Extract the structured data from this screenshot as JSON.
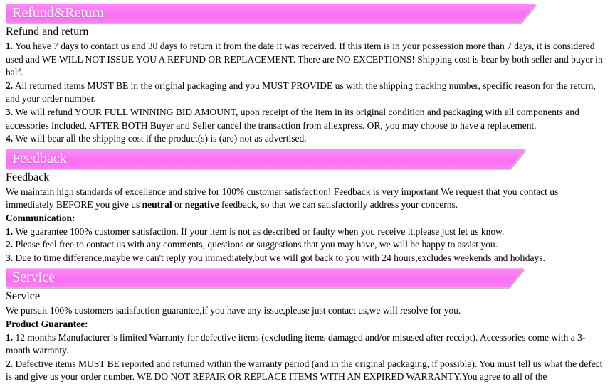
{
  "theme": {
    "banner_pink": "#fa7ef5",
    "banner_text": "#ffffff",
    "body_text": "#000000",
    "background": "#ffffff"
  },
  "sections": {
    "refund": {
      "banner_title": "Refund&Return",
      "subheading": "Refund and return",
      "items": [
        {
          "number": "1.",
          "text": " You have 7 days to contact us and 30 days to return it from the date it was received. If this item is in your possession more than 7 days, it is considered used and WE WILL NOT ISSUE YOU A REFUND OR REPLACEMENT. There are NO EXCEPTIONS! Shipping cost is bear by both seller and buyer in half."
        },
        {
          "number": "2.",
          "text": " All returned items MUST BE in the original packaging and you MUST PROVIDE us with the shipping tracking number, specific reason for the return, and your order number."
        },
        {
          "number": "3.",
          "text": " We will refund YOUR FULL WINNING BID AMOUNT, upon receipt of the item in its original condition and packaging with all components and accessories included, AFTER BOTH Buyer and Seller cancel the transaction from aliexpress. OR, you may choose to have a replacement."
        },
        {
          "number": "4.",
          "text": "  We will bear all the shipping cost if the product(s) is (are) not as advertised."
        }
      ]
    },
    "feedback": {
      "banner_title": "Feedback",
      "subheading": "Feedback",
      "intro_part1": "We maintain high standards of excellence and strive for 100% customer satisfaction! Feedback is very important We request that you contact us immediately BEFORE you give us ",
      "intro_bold1": "neutral",
      "intro_mid": " or ",
      "intro_bold2": "negative",
      "intro_part2": " feedback, so that we can satisfactorily address your concerns.",
      "communication_label": "Communication:",
      "items": [
        {
          "number": "1.",
          "text": " We guarantee 100% customer satisfaction. If your item is not as described or faulty when you receive it,please just let us know."
        },
        {
          "number": "2.",
          "text": " Please feel free to contact us with any comments, questions or suggestions that you may have, we will be happy to assist you."
        },
        {
          "number": "3.",
          "text": " Due to time difference,maybe we can't reply you immediately,but we will got back to you with 24 hours,excludes weekends and holidays."
        }
      ]
    },
    "service": {
      "banner_title": "Service",
      "subheading": "Service",
      "intro": "We pursuit 100% customers satisfaction guarantee,if you have any issue,please just contact us,we will resolve for you.",
      "guarantee_label": "Product Guarantee:",
      "items": [
        {
          "number": "1.",
          "text": " 12 months Manufacturer`s limited Warranty for defective items (excluding items damaged and/or misused after receipt). Accessories come with a 3-month warranty."
        },
        {
          "number": "2.",
          "text": " Defective items MUST BE reported and returned within the warranty period (and in the original packaging, if possible). You must tell us what the defect is and give us your order number. WE DO NOT REPAIR OR REPLACE ITEMS WITH AN EXPIRED WARRANTY.You agree to all of the"
        }
      ]
    }
  }
}
